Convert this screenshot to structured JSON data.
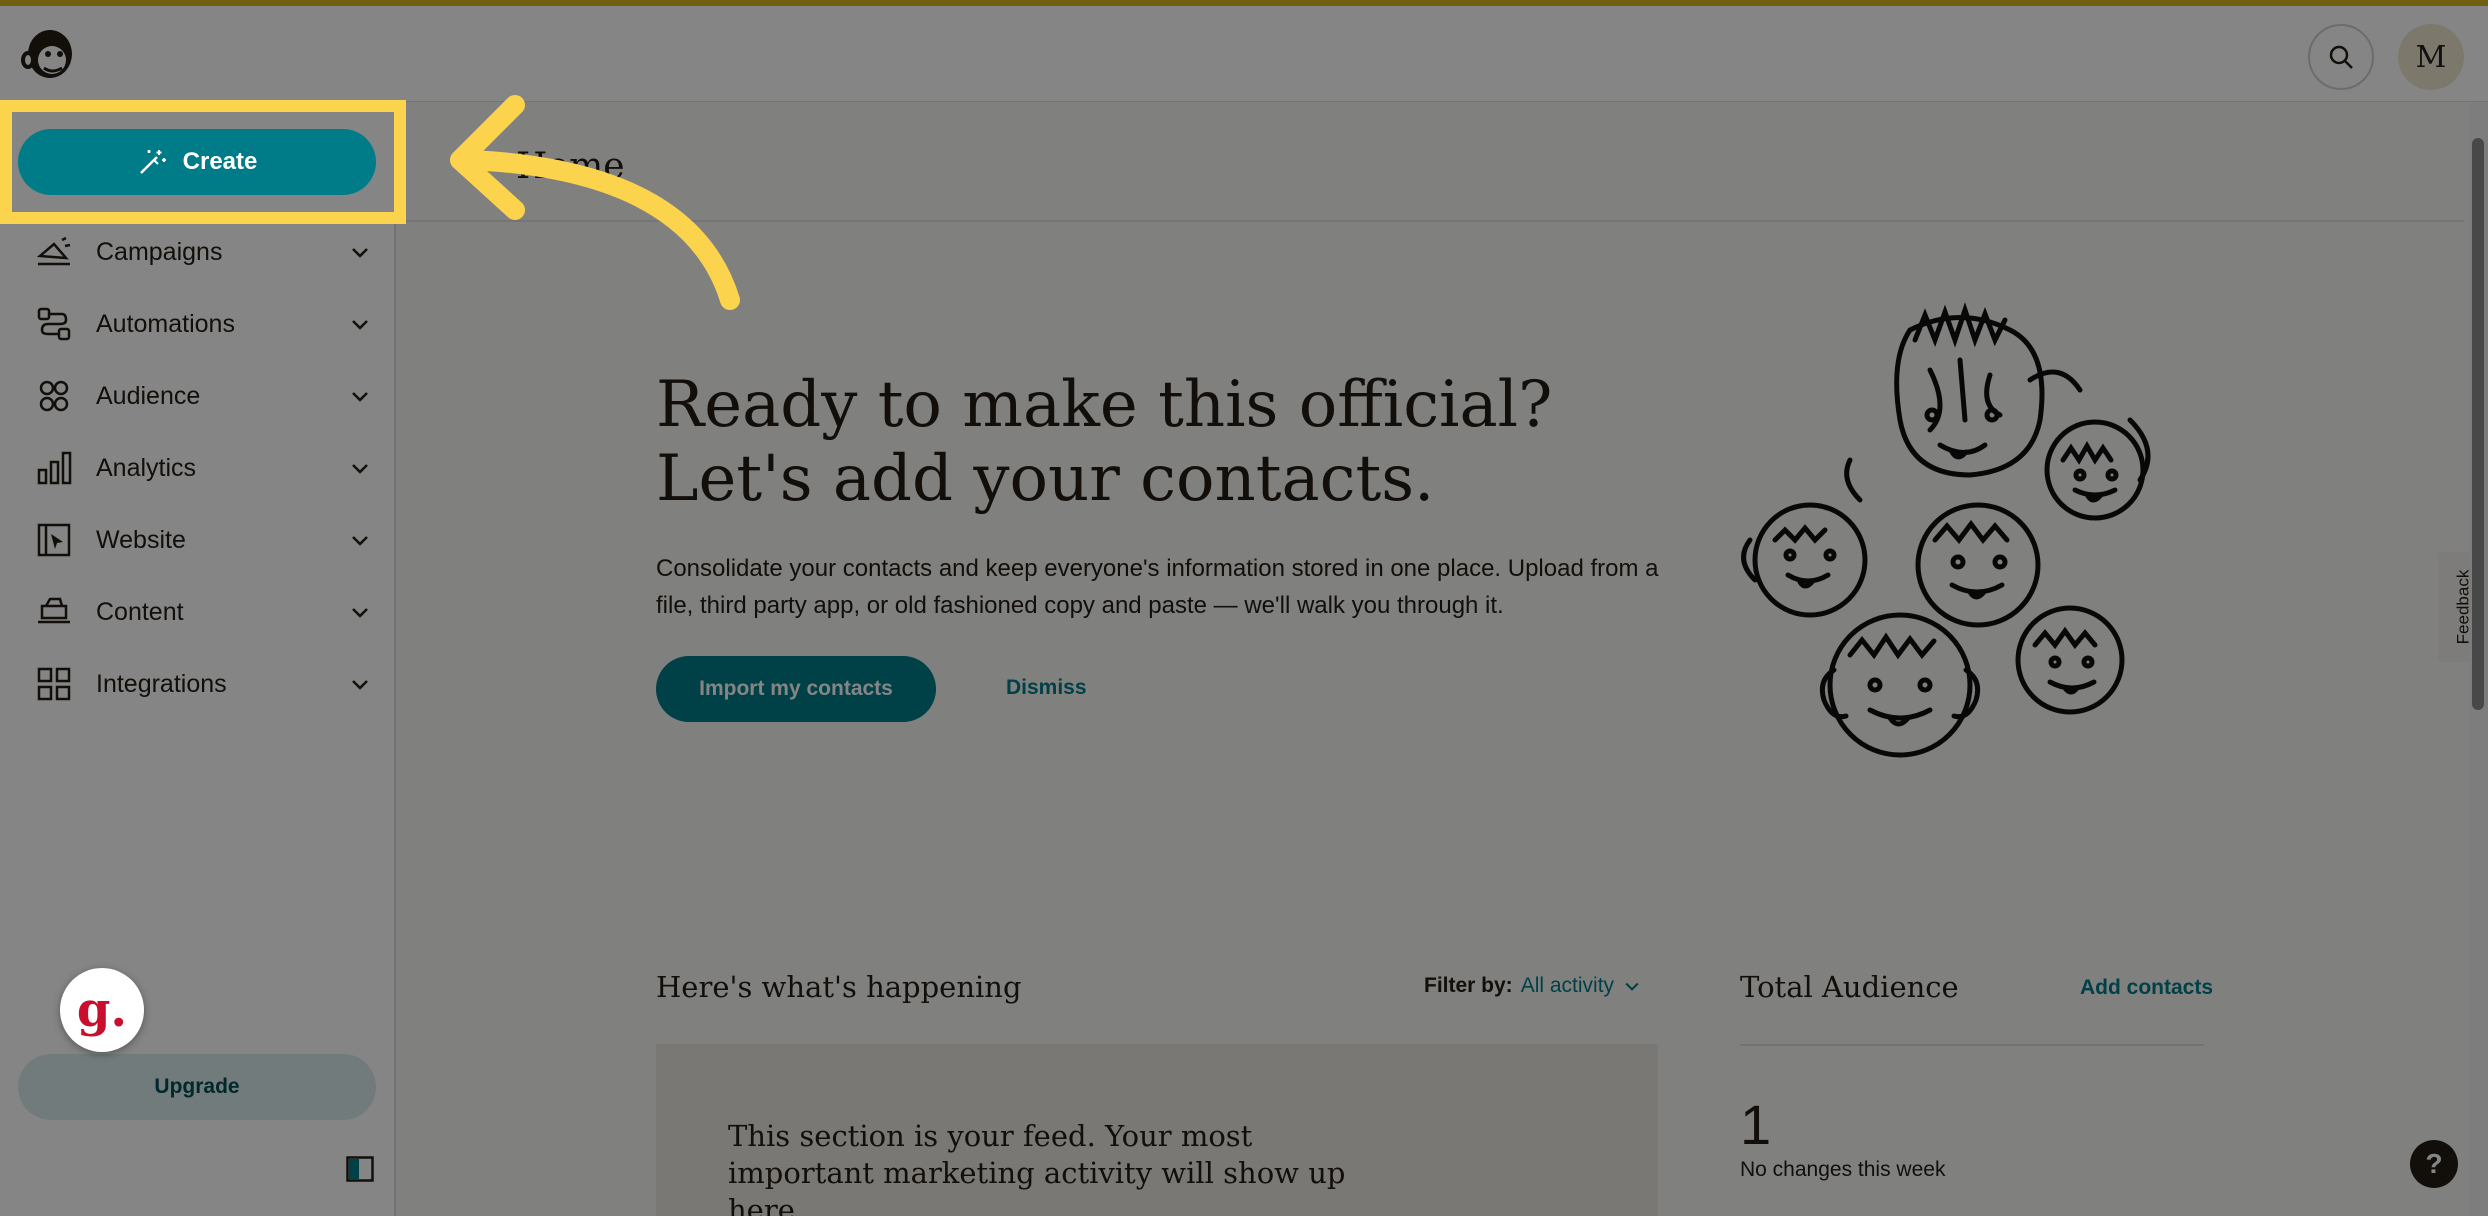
{
  "page": {
    "title": "Home"
  },
  "sidebar": {
    "create_label": "Create",
    "items": [
      {
        "label": "Campaigns",
        "icon": "megaphone-icon"
      },
      {
        "label": "Automations",
        "icon": "workflow-icon"
      },
      {
        "label": "Audience",
        "icon": "audience-icon"
      },
      {
        "label": "Analytics",
        "icon": "bar-chart-icon"
      },
      {
        "label": "Website",
        "icon": "website-icon"
      },
      {
        "label": "Content",
        "icon": "content-icon"
      },
      {
        "label": "Integrations",
        "icon": "grid-icon"
      }
    ],
    "upgrade_label": "Upgrade"
  },
  "header": {
    "avatar_initial": "M"
  },
  "hero": {
    "title_line1": "Ready to make this official?",
    "title_line2": "Let's add your contacts.",
    "text": "Consolidate your contacts and keep everyone's information stored in one place. Upload from a file, third party app, or old fashioned copy and paste — we'll walk you through it.",
    "import_label": "Import my contacts",
    "dismiss_label": "Dismiss"
  },
  "feed": {
    "title": "Here's what's happening",
    "filter_label": "Filter by:",
    "filter_value": "All activity",
    "card_text": "This section is your feed. Your most important marketing activity will show up here."
  },
  "audience": {
    "title": "Total Audience",
    "add_label": "Add contacts",
    "count": "1",
    "changes": "No changes this week"
  },
  "feedback_label": "Feedback",
  "help_label": "?",
  "g_badge": "g.",
  "colors": {
    "accent": "#007c89",
    "highlight": "#fcd34d",
    "brand_bar": "#d8b620"
  }
}
